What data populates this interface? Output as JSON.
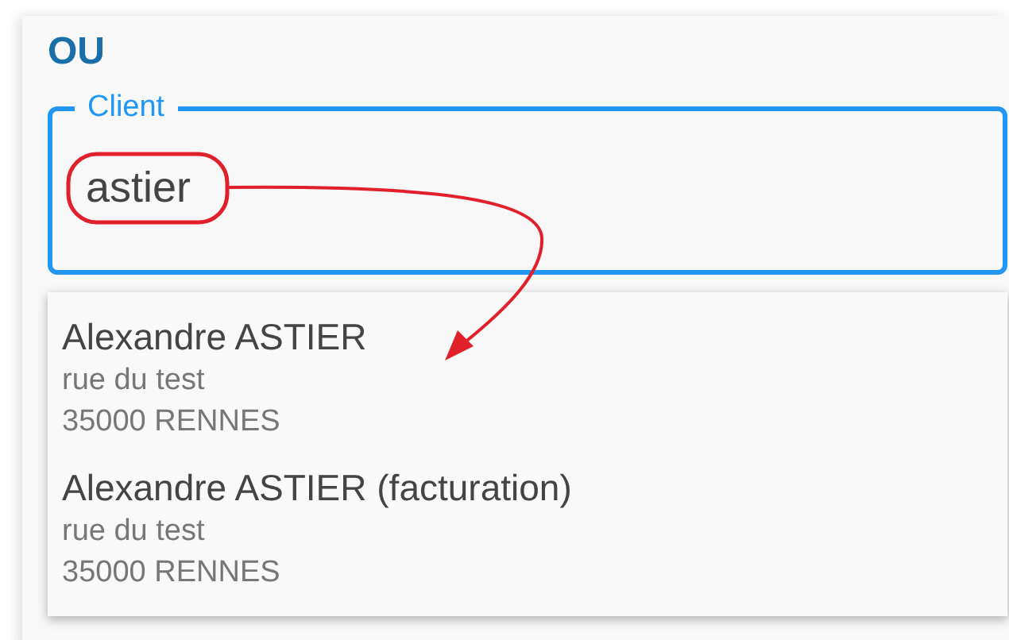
{
  "section_title": "OU",
  "client_field": {
    "label": "Client",
    "value": "astier"
  },
  "suggestions": [
    {
      "name": "Alexandre ASTIER",
      "street": "rue du test",
      "city": "35000 RENNES"
    },
    {
      "name": "Alexandre ASTIER (facturation)",
      "street": "rue du test",
      "city": "35000 RENNES"
    }
  ]
}
